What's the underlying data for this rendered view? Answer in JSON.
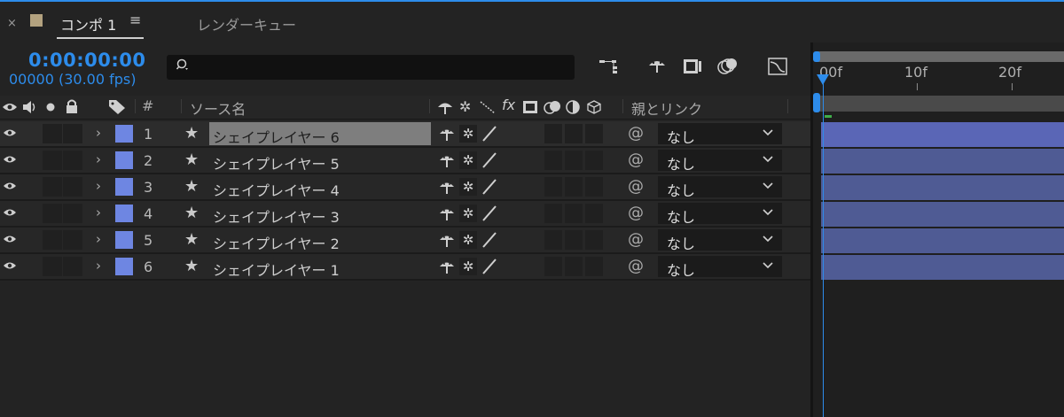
{
  "tabs": {
    "comp_label": "コンポ 1",
    "close": "×",
    "menu": "≡",
    "render_queue_label": "レンダーキュー"
  },
  "time": {
    "timecode": "0:00:00:00",
    "frames": "00000 (30.00 fps)"
  },
  "search": {
    "placeholder": ""
  },
  "columns": {
    "hash": "#",
    "source_name": "ソース名",
    "fx": "fx",
    "parent_link": "親とリンク"
  },
  "layers": [
    {
      "num": "1",
      "name": "シェイプレイヤー 6",
      "parent": "なし",
      "selected": true
    },
    {
      "num": "2",
      "name": "シェイプレイヤー 5",
      "parent": "なし",
      "selected": false
    },
    {
      "num": "3",
      "name": "シェイプレイヤー 4",
      "parent": "なし",
      "selected": false
    },
    {
      "num": "4",
      "name": "シェイプレイヤー 3",
      "parent": "なし",
      "selected": false
    },
    {
      "num": "5",
      "name": "シェイプレイヤー 2",
      "parent": "なし",
      "selected": false
    },
    {
      "num": "6",
      "name": "シェイプレイヤー 1",
      "parent": "なし",
      "selected": false
    }
  ],
  "ruler": {
    "labels": [
      "00f",
      "10f",
      "20f"
    ]
  },
  "colors": {
    "accent": "#2d8ceb",
    "label": "#6e86e2",
    "layer_bar": "#4f5b94"
  }
}
